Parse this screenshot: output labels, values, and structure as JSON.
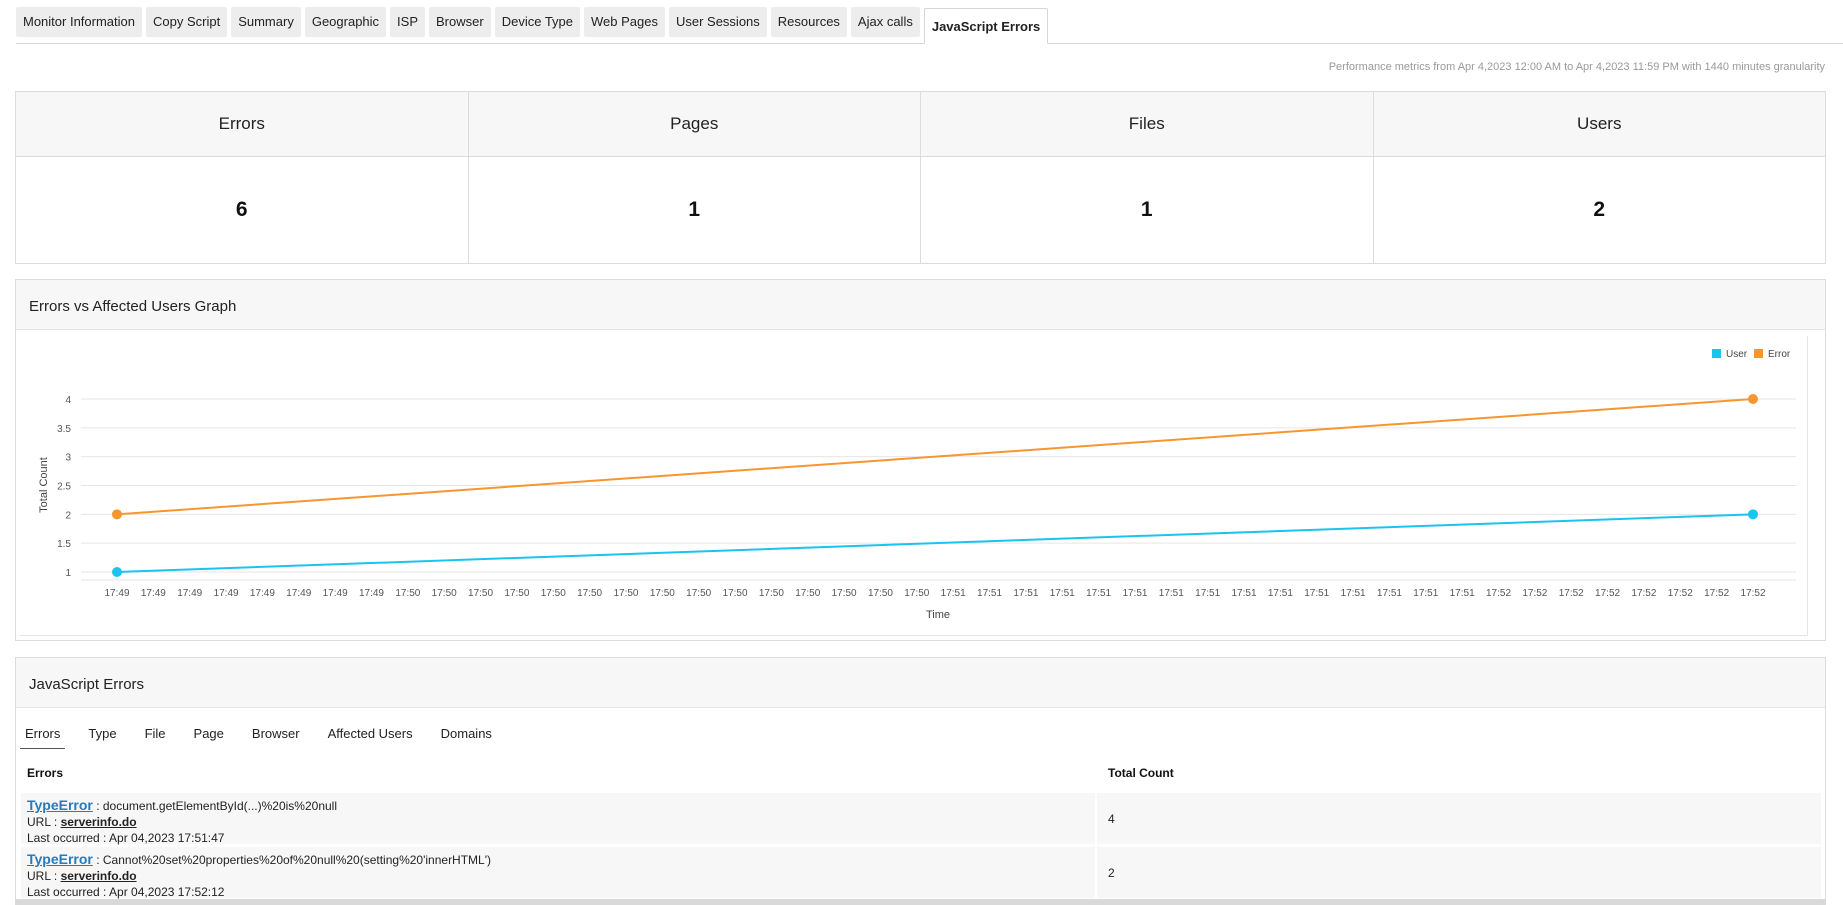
{
  "tabs": [
    {
      "label": "Monitor Information"
    },
    {
      "label": "Copy Script"
    },
    {
      "label": "Summary"
    },
    {
      "label": "Geographic"
    },
    {
      "label": "ISP"
    },
    {
      "label": "Browser"
    },
    {
      "label": "Device Type"
    },
    {
      "label": "Web Pages"
    },
    {
      "label": "User Sessions"
    },
    {
      "label": "Resources"
    },
    {
      "label": "Ajax calls"
    },
    {
      "label": "JavaScript Errors",
      "active": true
    }
  ],
  "perf_text": "Performance metrics from Apr 4,2023 12:00 AM to Apr 4,2023 11:59 PM with 1440 minutes granularity",
  "summary": [
    {
      "label": "Errors",
      "value": "6"
    },
    {
      "label": "Pages",
      "value": "1"
    },
    {
      "label": "Files",
      "value": "1"
    },
    {
      "label": "Users",
      "value": "2"
    }
  ],
  "graph_title": "Errors vs Affected Users Graph",
  "colors": {
    "user": "#1bc4ee",
    "error": "#f7962f"
  },
  "chart_data": {
    "type": "line",
    "title": "",
    "xlabel": "Time",
    "ylabel": "Total Count",
    "ylim": [
      1,
      4
    ],
    "yticks": [
      "1",
      "1.5",
      "2",
      "2.5",
      "3",
      "3.5",
      "4"
    ],
    "xticks": [
      "17:49",
      "17:49",
      "17:49",
      "17:49",
      "17:49",
      "17:49",
      "17:49",
      "17:49",
      "17:50",
      "17:50",
      "17:50",
      "17:50",
      "17:50",
      "17:50",
      "17:50",
      "17:50",
      "17:50",
      "17:50",
      "17:50",
      "17:50",
      "17:50",
      "17:50",
      "17:50",
      "17:51",
      "17:51",
      "17:51",
      "17:51",
      "17:51",
      "17:51",
      "17:51",
      "17:51",
      "17:51",
      "17:51",
      "17:51",
      "17:51",
      "17:51",
      "17:51",
      "17:51",
      "17:52",
      "17:52",
      "17:52",
      "17:52",
      "17:52",
      "17:52",
      "17:52",
      "17:52"
    ],
    "legend": "top-right",
    "grid": true,
    "series": [
      {
        "name": "User",
        "color": "#1bc4ee",
        "points": [
          {
            "x": "17:49",
            "y": 1
          },
          {
            "x": "17:52",
            "y": 2
          }
        ]
      },
      {
        "name": "Error",
        "color": "#f7962f",
        "points": [
          {
            "x": "17:49",
            "y": 2
          },
          {
            "x": "17:52",
            "y": 4
          }
        ]
      }
    ]
  },
  "errors_panel": {
    "title": "JavaScript Errors",
    "subtabs": [
      "Errors",
      "Type",
      "File",
      "Page",
      "Browser",
      "Affected Users",
      "Domains"
    ],
    "columns": [
      "Errors",
      "Total Count"
    ],
    "rows": [
      {
        "type": "TypeError",
        "message": " : document.getElementById(...)%20is%20null",
        "url_label": "URL : ",
        "url": "serverinfo.do",
        "last_occurred": "Last occurred : Apr 04,2023 17:51:47",
        "count": "4"
      },
      {
        "type": "TypeError",
        "message": " : Cannot%20set%20properties%20of%20null%20(setting%20'innerHTML')",
        "url_label": "URL : ",
        "url": "serverinfo.do",
        "last_occurred": "Last occurred : Apr 04,2023 17:52:12",
        "count": "2"
      }
    ]
  }
}
